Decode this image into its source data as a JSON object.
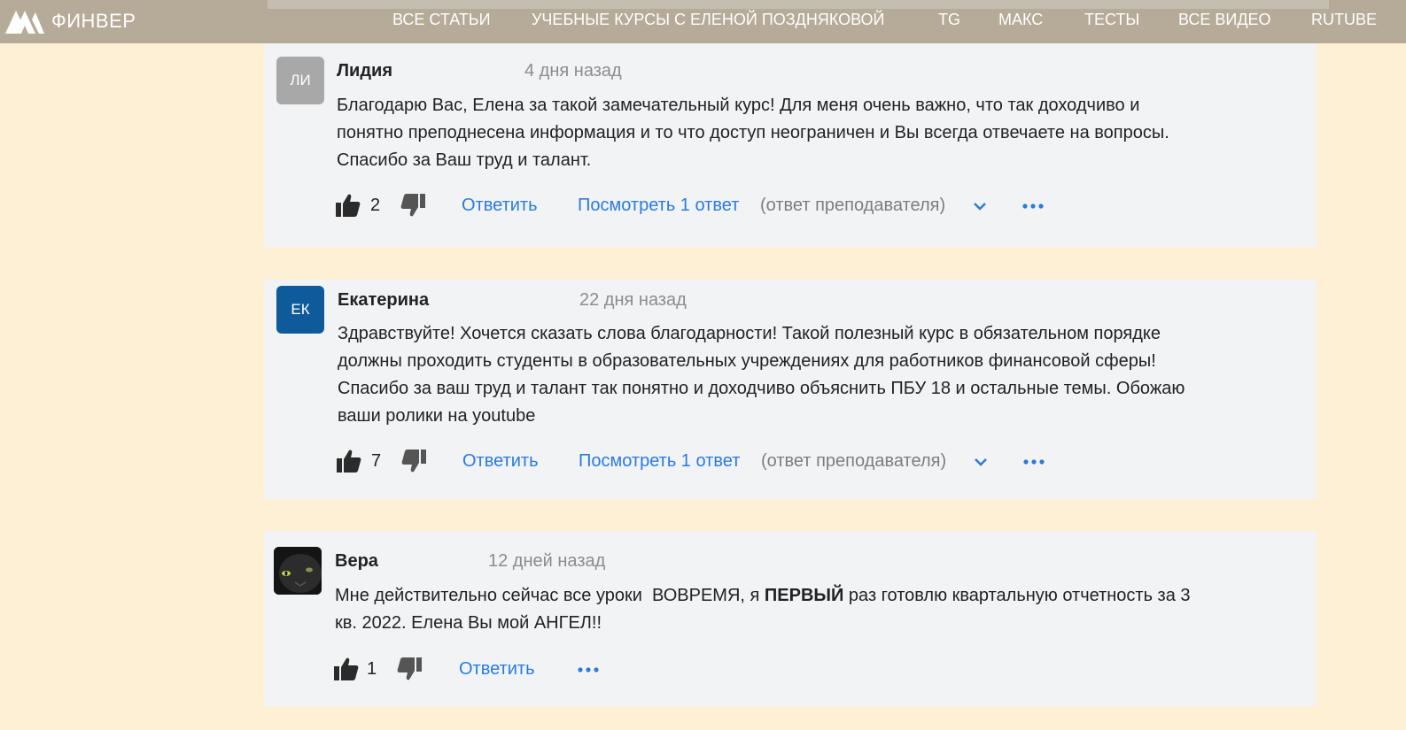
{
  "header": {
    "logo_text": "ФИНВЕР",
    "nav": [
      "ВСЕ СТАТЬИ",
      "УЧЕБНЫЕ КУРСЫ С ЕЛЕНОЙ ПОЗДНЯКОВОЙ",
      "TG",
      "МАКС",
      "ТЕСТЫ",
      "ВСЕ ВИДЕО",
      "RUTUBE"
    ]
  },
  "colors": {
    "page_bg": "#fdf0d5",
    "header_bg": "#b5ab98",
    "card_bg": "#f1f3f5",
    "link": "#2a7ae2",
    "avatar_li": "#a8a8a8",
    "avatar_ek": "#0e5a9a"
  },
  "comments": [
    {
      "avatar_text": "ЛИ",
      "author": "Лидия",
      "time": "4 дня назад",
      "lines": [
        "Благодарю Вас, Елена за такой замечательный курс! Для меня очень важно, что так доходчиво и",
        "понятно преподнесена информация и то что доступ неограничен и Вы всегда отвечаете на вопросы.",
        "Спасибо за Ваш труд и талант."
      ],
      "likes": "2",
      "reply_label": "Ответить",
      "view_replies": "Посмотреть 1 ответ",
      "reply_note": "(ответ преподавателя)"
    },
    {
      "avatar_text": "ЕК",
      "author": "Екатерина",
      "time": "22 дня назад",
      "lines": [
        "Здравствуйте! Хочется сказать слова благодарности! Такой полезный курс в обязательном порядке",
        "должны проходить студенты в образовательных учреждениях для работников финансовой сферы!",
        "Спасибо за ваш труд и талант так понятно и доходчиво объяснить ПБУ 18 и остальные темы. Обожаю",
        "ваши ролики на youtube"
      ],
      "likes": "7",
      "reply_label": "Ответить",
      "view_replies": "Посмотреть 1 ответ",
      "reply_note": "(ответ преподавателя)"
    },
    {
      "avatar_icon": "cat-photo-avatar",
      "author": "Вера",
      "time": "12 дней назад",
      "line1_pre": "Мне действительно сейчас все уроки  ВОВРЕМЯ, я ",
      "line1_bold": "ПЕРВЫЙ",
      "line1_post": " раз готовлю квартальную отчетность за 3",
      "line2": "кв. 2022. Елена Вы мой АНГЕЛ!!",
      "likes": "1",
      "reply_label": "Ответить"
    }
  ]
}
